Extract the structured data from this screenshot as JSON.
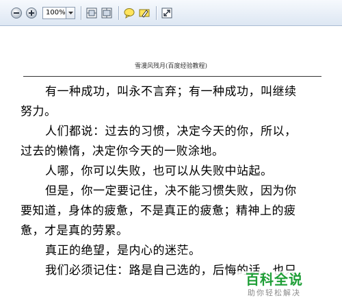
{
  "toolbar": {
    "zoom_value": "100%",
    "icons": [
      "zoom-out-icon",
      "zoom-in-icon",
      "zoom-dropdown-icon",
      "fit-page-icon",
      "fit-width-icon",
      "comment-icon",
      "highlight-icon",
      "expand-icon"
    ]
  },
  "document": {
    "header": "雪漫风残月(百度经验教程)",
    "paragraphs": [
      {
        "lines": [
          "有一种成功，叫永不言弃；有一种成功，叫继续",
          "努力。"
        ]
      },
      {
        "lines": [
          "人们都说：过去的习惯，决定今天的你，所以，",
          "过去的懒惰，决定你今天的一败涂地。"
        ]
      },
      {
        "lines": [
          "人哪，你可以失败，也可以从失败中站起。"
        ]
      },
      {
        "lines": [
          "但是，你一定要记住，决不能习惯失败，因为你",
          "要知道，身体的疲惫，不是真正的疲惫；精神上的疲",
          "惫，才是真的劳累。"
        ]
      },
      {
        "lines": [
          "真正的绝望，是内心的迷茫。"
        ]
      },
      {
        "lines": [
          "我们必须记住：路是自己选的，后悔的话，也只"
        ]
      }
    ]
  },
  "watermark": {
    "title": "百科全说",
    "subtitle": "助你轻松解决"
  },
  "colors": {
    "toolbar_bg": "#e6edf6",
    "watermark_green": "#1e9e36"
  }
}
